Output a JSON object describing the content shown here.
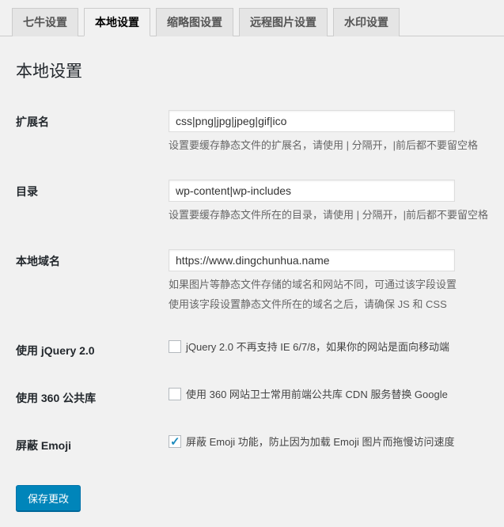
{
  "tabs": [
    {
      "label": "七牛设置",
      "active": false
    },
    {
      "label": "本地设置",
      "active": true
    },
    {
      "label": "缩略图设置",
      "active": false
    },
    {
      "label": "远程图片设置",
      "active": false
    },
    {
      "label": "水印设置",
      "active": false
    }
  ],
  "section_title": "本地设置",
  "fields": {
    "ext": {
      "label": "扩展名",
      "value": "css|png|jpg|jpeg|gif|ico",
      "description": "设置要缓存静态文件的扩展名，请使用 | 分隔开，|前后都不要留空格"
    },
    "dirs": {
      "label": "目录",
      "value": "wp-content|wp-includes",
      "description": "设置要缓存静态文件所在的目录，请使用 | 分隔开，|前后都不要留空格"
    },
    "domain": {
      "label": "本地域名",
      "value": "https://www.dingchunhua.name",
      "description_line1": "如果图片等静态文件存储的域名和网站不同，可通过该字段设置",
      "description_line2": "使用该字段设置静态文件所在的域名之后，请确保 JS 和 CSS"
    },
    "jquery": {
      "label": "使用 jQuery 2.0",
      "checked": false,
      "checkbox_label": "jQuery 2.0 不再支持 IE 6/7/8，如果你的网站是面向移动端"
    },
    "lib360": {
      "label": "使用 360 公共库",
      "checked": false,
      "checkbox_label": "使用 360 网站卫士常用前端公共库 CDN 服务替换 Google"
    },
    "emoji": {
      "label": "屏蔽 Emoji",
      "checked": true,
      "checkbox_label": "屏蔽 Emoji 功能，防止因为加载 Emoji 图片而拖慢访问速度"
    }
  },
  "submit_label": "保存更改"
}
